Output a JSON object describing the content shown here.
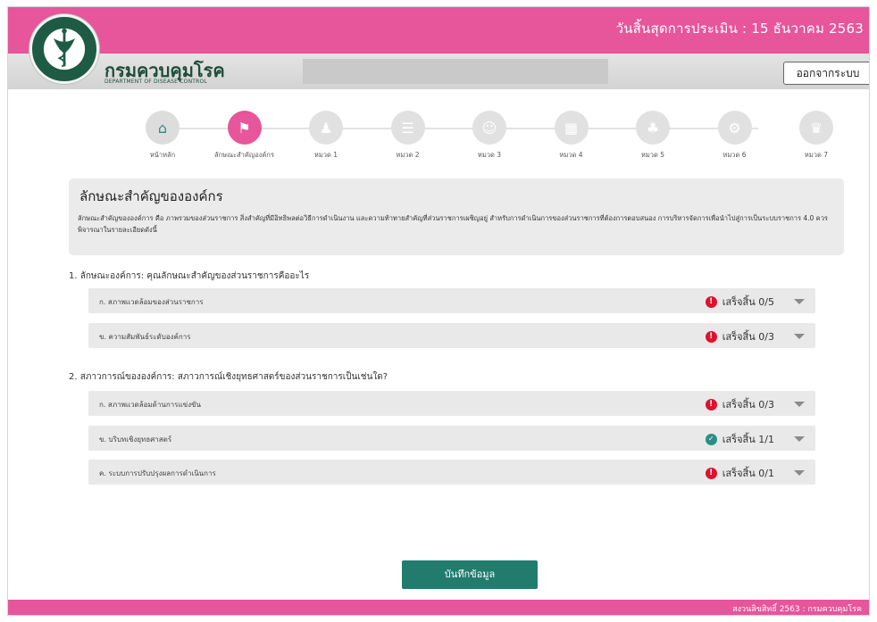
{
  "header": {
    "deadline": "วันสิ้นสุดการประเมิน : 15 ธันวาคม 2563",
    "dept_name_th": "กรมควบคุมโรค",
    "dept_name_en": "DEPARTMENT OF DISEASE CONTROL",
    "logout_label": "ออกจากระบบ"
  },
  "stepper": [
    {
      "label": "หน้าหลัก",
      "icon": "home-icon",
      "glyph": "⌂",
      "state": "done"
    },
    {
      "label": "ลักษณะสำคัญองค์กร",
      "icon": "flag-icon",
      "glyph": "⚑",
      "state": "active"
    },
    {
      "label": "หมวด 1",
      "icon": "leadership-icon",
      "glyph": "♟",
      "state": "pending"
    },
    {
      "label": "หมวด 2",
      "icon": "strategy-signpost-icon",
      "glyph": "☰",
      "state": "pending"
    },
    {
      "label": "หมวด 3",
      "icon": "customers-icon",
      "glyph": "☺",
      "state": "pending"
    },
    {
      "label": "หมวด 4",
      "icon": "chart-icon",
      "glyph": "▦",
      "state": "pending"
    },
    {
      "label": "หมวด 5",
      "icon": "staff-icon",
      "glyph": "♣",
      "state": "pending"
    },
    {
      "label": "หมวด 6",
      "icon": "process-network-icon",
      "glyph": "⚙",
      "state": "pending"
    },
    {
      "label": "หมวด 7",
      "icon": "trophy-icon",
      "glyph": "♛",
      "state": "pending"
    }
  ],
  "intro": {
    "title": "ลักษณะสำคัญขององค์กร",
    "body": "ลักษณะสำคัญขององค์การ คือ ภาพรวมของส่วนราชการ สิ่งสำคัญที่มีอิทธิพลต่อวิธีการดำเนินงาน และความท้าทายสำคัญที่ส่วนราชการเผชิญอยู่ สำหรับการดำเนินการของส่วนราชการที่ต้องการตอบสนอง การบริหารจัดการเพื่อนำไปสู่การเป็นระบบราชการ 4.0 ควรพิจารณาในรายละเอียดดังนี้"
  },
  "sections": [
    {
      "title": "1. ลักษณะองค์การ: คุณลักษณะสำคัญของส่วนราชการคืออะไร",
      "items": [
        {
          "label": "ก. สภาพแวดล้อมของส่วนราชการ",
          "status": "เสร็จสิ้น 0/5",
          "state": "warn"
        },
        {
          "label": "ข. ความสัมพันธ์ระดับองค์การ",
          "status": "เสร็จสิ้น 0/3",
          "state": "warn"
        }
      ]
    },
    {
      "title": "2. สภาวการณ์ขององค์การ: สภาวการณ์เชิงยุทธศาสตร์ของส่วนราชการเป็นเช่นใด?",
      "items": [
        {
          "label": "ก. สภาพแวดล้อมด้านการแข่งขัน",
          "status": "เสร็จสิ้น 0/3",
          "state": "warn"
        },
        {
          "label": "ข. บริบทเชิงยุทธศาสตร์",
          "status": "เสร็จสิ้น 1/1",
          "state": "ok"
        },
        {
          "label": "ค. ระบบการปรับปรุงผลการดำเนินการ",
          "status": "เสร็จสิ้น 0/1",
          "state": "warn"
        }
      ]
    }
  ],
  "save_label": "บันทึกข้อมูล",
  "footer": {
    "copyright": "สงวนลิขสิทธิ์ 2563 : กรมควบคุมโรค"
  },
  "colors": {
    "brand_pink": "#e7559b",
    "brand_teal": "#227c6e",
    "warning_red": "#e0112e",
    "ok_teal": "#2b8f84"
  }
}
